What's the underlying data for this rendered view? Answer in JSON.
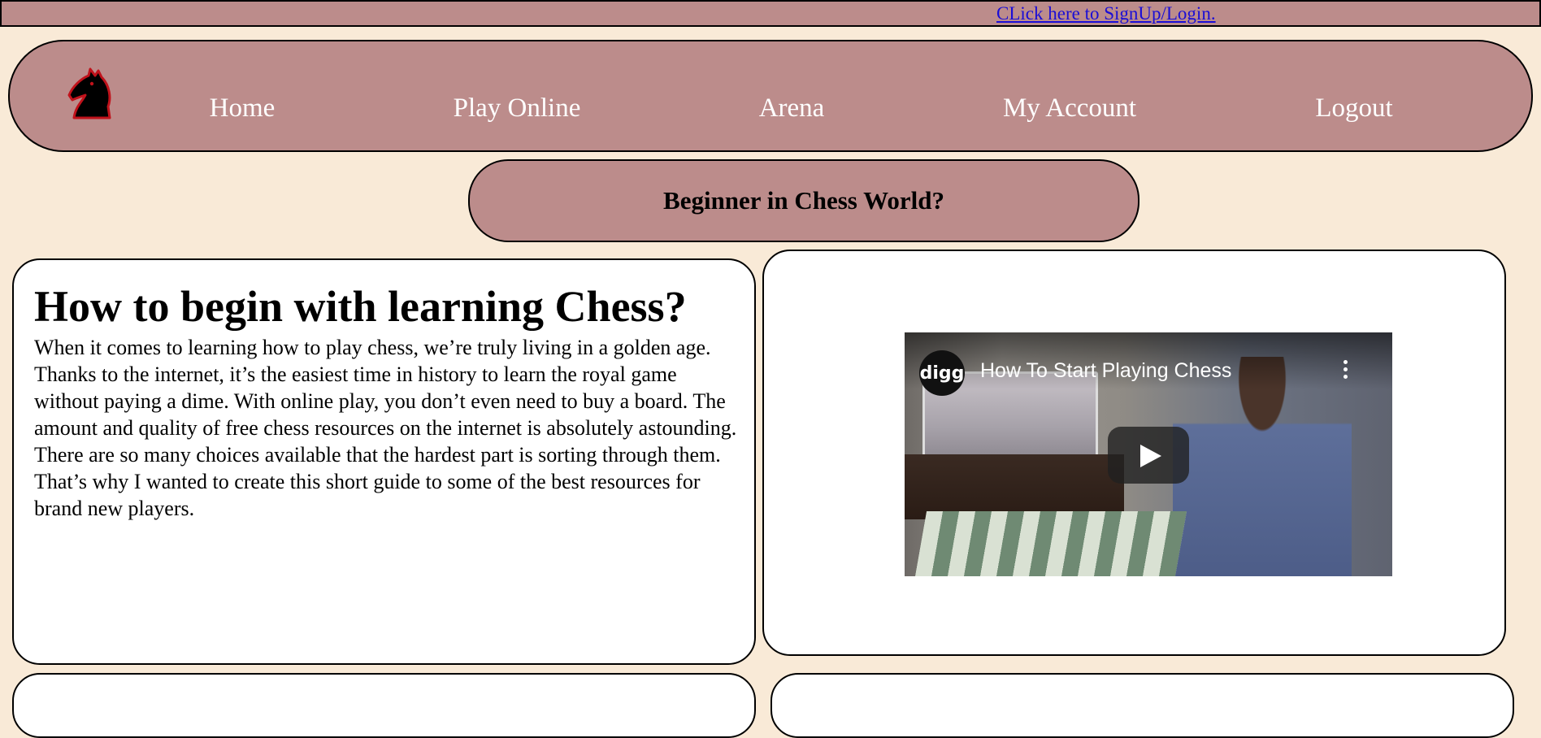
{
  "topbar": {
    "signup_link": "CLick here to SignUp/Login."
  },
  "nav": {
    "logo": "chess-knight-icon",
    "items": [
      {
        "label": "Home"
      },
      {
        "label": "Play Online"
      },
      {
        "label": "Arena"
      },
      {
        "label": "My Account"
      },
      {
        "label": "Logout"
      }
    ]
  },
  "banner": {
    "text": "Beginner in Chess World?"
  },
  "intro": {
    "heading": "How to begin with learning Chess?",
    "body": "When it comes to learning how to play chess, we’re truly living in a golden age. Thanks to the internet, it’s the easiest time in history to learn the royal game without paying a dime. With online play, you don’t even need to buy a board. The amount and quality of free chess resources on the internet is absolutely astounding. There are so many choices available that the hardest part is sorting through them. That’s why I wanted to create this short guide to some of the best resources for brand new players."
  },
  "video": {
    "channel": "digg",
    "title": "How To Start Playing Chess"
  },
  "colors": {
    "background": "#f9ead7",
    "bar": "#bc8c8b",
    "link": "#1a0dd6"
  }
}
